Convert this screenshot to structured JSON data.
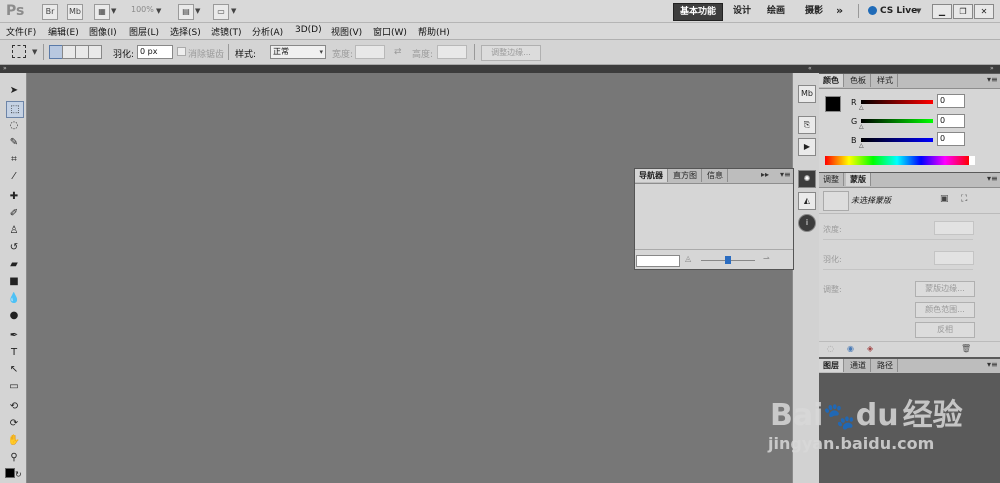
{
  "titlebar": {
    "logo": "Ps",
    "br": "Br",
    "mb": "Mb",
    "zoom": "100%",
    "workspaces": [
      "基本功能",
      "设计",
      "绘画",
      "摄影"
    ],
    "more": "»",
    "cslive": "CS Live"
  },
  "menubar": {
    "items": [
      "文件(F)",
      "编辑(E)",
      "图像(I)",
      "图层(L)",
      "选择(S)",
      "滤镜(T)",
      "分析(A)",
      "3D(D)",
      "视图(V)",
      "窗口(W)",
      "帮助(H)"
    ]
  },
  "options": {
    "feather_label": "羽化:",
    "feather_value": "0 px",
    "antialias_label": "消除锯齿",
    "style_label": "样式:",
    "style_value": "正常",
    "width_label": "宽度:",
    "height_label": "高度:",
    "refine_edge": "调整边缘..."
  },
  "color_panel": {
    "tabs": [
      "颜色",
      "色板",
      "样式"
    ],
    "r_label": "R",
    "g_label": "G",
    "b_label": "B",
    "r_value": "0",
    "g_value": "0",
    "b_value": "0"
  },
  "masks_panel": {
    "tabs": [
      "调整",
      "蒙版"
    ],
    "no_mask": "未选择蒙版",
    "density_label": "浓度:",
    "feather_label": "羽化:",
    "refine_label": "调整:",
    "mask_edge": "蒙版边缘...",
    "color_range": "颜色范围...",
    "invert": "反相"
  },
  "layers_panel": {
    "tabs": [
      "图层",
      "通道",
      "路径"
    ]
  },
  "navigator": {
    "tabs": [
      "导航器",
      "直方图",
      "信息"
    ]
  },
  "watermark": {
    "brand": "Bai",
    "brand2": "du",
    "cn": "经验",
    "url": "jingyan.baidu.com"
  },
  "colors": {
    "canvas": "#777777",
    "chrome": "#d9d9d9",
    "dark": "#3c3c3c"
  }
}
